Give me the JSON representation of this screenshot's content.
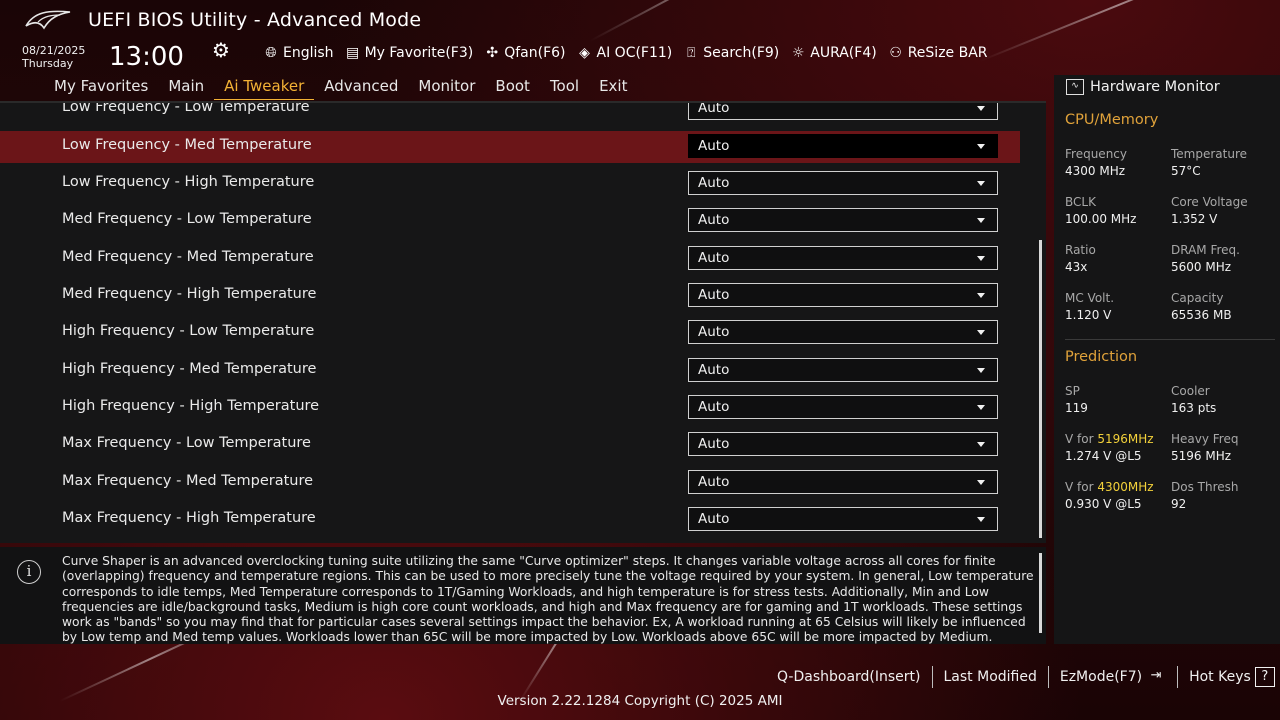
{
  "header": {
    "title": "UEFI BIOS Utility - Advanced Mode",
    "date": "08/21/2025",
    "weekday": "Thursday",
    "time": "13:00",
    "tools": [
      {
        "icon": "globe-icon",
        "label": "English"
      },
      {
        "icon": "my-favorite-icon",
        "label": "My Favorite(F3)"
      },
      {
        "icon": "fan-icon",
        "label": "Qfan(F6)"
      },
      {
        "icon": "ai-oc-icon",
        "label": "AI OC(F11)"
      },
      {
        "icon": "search-icon",
        "label": "Search(F9)"
      },
      {
        "icon": "aura-icon",
        "label": "AURA(F4)"
      },
      {
        "icon": "resize-bar-icon",
        "label": "ReSize BAR"
      }
    ]
  },
  "tabs": [
    "My Favorites",
    "Main",
    "Ai Tweaker",
    "Advanced",
    "Monitor",
    "Boot",
    "Tool",
    "Exit"
  ],
  "active_tab": "Ai Tweaker",
  "settings": [
    {
      "label": "Low Frequency - Low Temperature",
      "value": "Auto"
    },
    {
      "label": "Low Frequency - Med Temperature",
      "value": "Auto",
      "selected": true
    },
    {
      "label": "Low Frequency - High Temperature",
      "value": "Auto"
    },
    {
      "label": "Med Frequency - Low Temperature",
      "value": "Auto"
    },
    {
      "label": "Med Frequency - Med Temperature",
      "value": "Auto"
    },
    {
      "label": "Med Frequency - High Temperature",
      "value": "Auto"
    },
    {
      "label": "High Frequency - Low Temperature",
      "value": "Auto"
    },
    {
      "label": "High Frequency - Med Temperature",
      "value": "Auto"
    },
    {
      "label": "High Frequency - High Temperature",
      "value": "Auto"
    },
    {
      "label": "Max Frequency - Low Temperature",
      "value": "Auto"
    },
    {
      "label": "Max Frequency - Med Temperature",
      "value": "Auto"
    },
    {
      "label": "Max Frequency - High Temperature",
      "value": "Auto"
    }
  ],
  "help": {
    "text": "Curve Shaper is an advanced overclocking tuning suite utilizing the same \"Curve optimizer\" steps. It changes variable voltage across all cores for finite (overlapping) frequency and temperature regions. This can be used to more precisely tune the voltage required by your system. In general, Low temperature corresponds to idle temps, Med Temperature corresponds to 1T/Gaming Workloads, and high temperature is for stress tests. Additionally, Min and Low frequencies are idle/background tasks, Medium is high core count workloads, and high and Max frequency are for gaming and 1T workloads. These settings work as \"bands\" so you may find that for particular cases several settings impact the behavior. Ex, A workload running at 65 Celsius will likely be influenced by Low temp and Med temp values. Workloads lower than 65C will be more impacted by Low. Workloads above 65C will be more impacted by Medium."
  },
  "hardware_monitor": {
    "title": "Hardware Monitor",
    "cpu_memory": {
      "heading": "CPU/Memory",
      "items": [
        {
          "label": "Frequency",
          "value": "4300 MHz"
        },
        {
          "label": "Temperature",
          "value": "57°C"
        },
        {
          "label": "BCLK",
          "value": "100.00 MHz"
        },
        {
          "label": "Core Voltage",
          "value": "1.352 V"
        },
        {
          "label": "Ratio",
          "value": "43x"
        },
        {
          "label": "DRAM Freq.",
          "value": "5600 MHz"
        },
        {
          "label": "MC Volt.",
          "value": "1.120 V"
        },
        {
          "label": "Capacity",
          "value": "65536 MB"
        }
      ]
    },
    "prediction": {
      "heading": "Prediction",
      "sp_label": "SP",
      "sp_value": "119",
      "cooler_label": "Cooler",
      "cooler_value": "163 pts",
      "v1_prefix": "V for ",
      "v1_freq": "5196MHz",
      "v1_value": "1.274 V @L5",
      "heavy_label": "Heavy Freq",
      "heavy_value": "5196 MHz",
      "v2_prefix": "V for ",
      "v2_freq": "4300MHz",
      "v2_value": "0.930 V @L5",
      "dos_label": "Dos Thresh",
      "dos_value": "92"
    }
  },
  "footer": {
    "qdashboard": "Q-Dashboard(Insert)",
    "last_modified": "Last Modified",
    "ezmode": "EzMode(F7)",
    "hotkeys": "Hot Keys",
    "hotkeys_key": "?",
    "version": "Version 2.22.1284 Copyright (C) 2025 AMI"
  },
  "colors": {
    "accent": "#f3b235",
    "selected_row": "#6b1518",
    "highlight_value": "#f3d13a"
  }
}
